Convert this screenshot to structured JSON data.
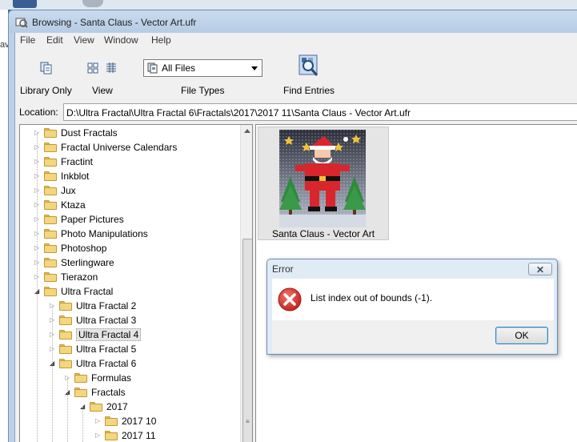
{
  "window": {
    "title": "Browsing - Santa Claus - Vector Art.ufr"
  },
  "menu": [
    "File",
    "Edit",
    "View",
    "Window",
    "Help"
  ],
  "toolbar": {
    "library_only_label": "Library Only",
    "view_label": "View",
    "file_types_label": "File Types",
    "file_types_value": "All Files",
    "find_entries_label": "Find Entries"
  },
  "location": {
    "label": "Location:",
    "value": "D:\\Ultra Fractal\\Ultra Fractal 6\\Fractals\\2017\\2017 11\\Santa Claus - Vector Art.ufr"
  },
  "tree": [
    {
      "label": "Dust Fractals",
      "level": 0,
      "expander": "closed"
    },
    {
      "label": "Fractal Universe Calendars",
      "level": 0,
      "expander": "closed"
    },
    {
      "label": "Fractint",
      "level": 0,
      "expander": "closed"
    },
    {
      "label": "Inkblot",
      "level": 0,
      "expander": "closed"
    },
    {
      "label": "Jux",
      "level": 0,
      "expander": "closed"
    },
    {
      "label": "Ktaza",
      "level": 0,
      "expander": "closed"
    },
    {
      "label": "Paper Pictures",
      "level": 0,
      "expander": "closed"
    },
    {
      "label": "Photo Manipulations",
      "level": 0,
      "expander": "closed"
    },
    {
      "label": "Photoshop",
      "level": 0,
      "expander": "closed"
    },
    {
      "label": "Sterlingware",
      "level": 0,
      "expander": "closed"
    },
    {
      "label": "Tierazon",
      "level": 0,
      "expander": "closed"
    },
    {
      "label": "Ultra Fractal",
      "level": 0,
      "expander": "open"
    },
    {
      "label": "Ultra Fractal 2",
      "level": 1,
      "expander": "closed"
    },
    {
      "label": "Ultra Fractal 3",
      "level": 1,
      "expander": "closed"
    },
    {
      "label": "Ultra Fractal 4",
      "level": 1,
      "expander": "closed",
      "selected": true
    },
    {
      "label": "Ultra Fractal 5",
      "level": 1,
      "expander": "closed"
    },
    {
      "label": "Ultra Fractal 6",
      "level": 1,
      "expander": "open"
    },
    {
      "label": "Formulas",
      "level": 2,
      "expander": "closed"
    },
    {
      "label": "Fractals",
      "level": 2,
      "expander": "open"
    },
    {
      "label": "2017",
      "level": 3,
      "expander": "open"
    },
    {
      "label": "2017 10",
      "level": 4,
      "expander": "closed"
    },
    {
      "label": "2017 11",
      "level": 4,
      "expander": "closed"
    }
  ],
  "content": {
    "items": [
      {
        "caption": "Santa Claus - Vector Art"
      }
    ]
  },
  "dialog": {
    "title": "Error",
    "close_symbol": "✕",
    "message": "List index out of bounds (-1).",
    "ok_label": "OK"
  },
  "desktop": {
    "left_edge_text": "av"
  },
  "colors": {
    "error_red": "#d9302b",
    "folder_yellow": "#f3d67f",
    "window_frame": "#bcd1e8"
  }
}
